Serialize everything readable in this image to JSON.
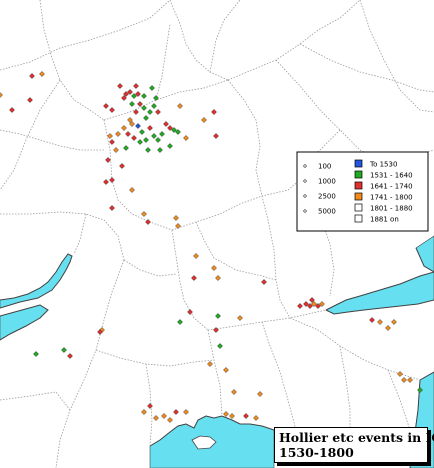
{
  "title": {
    "line1": "Hollier etc events in IGI",
    "line2": "1530-1800"
  },
  "colors": {
    "sea": "#66e0f0",
    "land": "#ffffff",
    "county_border": "#9a9a9a",
    "coast": "#444444"
  },
  "legend": {
    "sizes": [
      {
        "label": "100"
      },
      {
        "label": "1000"
      },
      {
        "label": "2500"
      },
      {
        "label": "5000"
      }
    ],
    "periods": [
      {
        "label": "To 1530",
        "color": "#2255dd"
      },
      {
        "label": "1531 - 1640",
        "color": "#22aa22"
      },
      {
        "label": "1641 - 1740",
        "color": "#e03030"
      },
      {
        "label": "1741 - 1800",
        "color": "#f08c1e"
      },
      {
        "label": "1801 - 1880",
        "color": "#ffffff"
      },
      {
        "label": "1881 on",
        "color": "#ffffff"
      }
    ]
  }
}
